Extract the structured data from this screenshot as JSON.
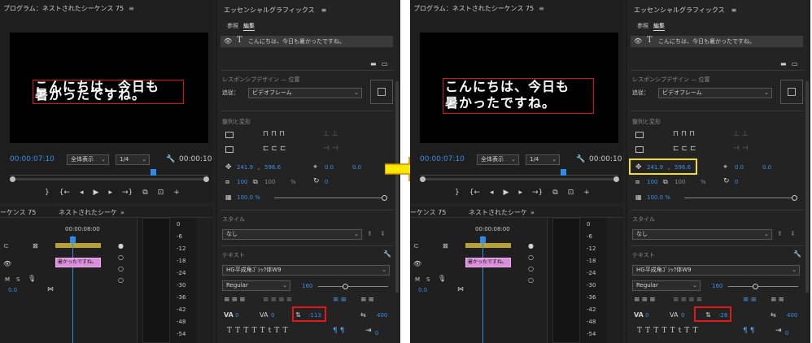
{
  "program_monitor": {
    "title": "プログラム：ネストされたシーケンス 75",
    "menu_icon": "≡",
    "timecode_left": "00:00:07:10",
    "fit_option": "全体表示",
    "quality_option": "1/4",
    "timecode_right": "00:00:10"
  },
  "preview_before": {
    "line1": "こんにちは、今日も",
    "line2": "暑かったですね。"
  },
  "preview_after": {
    "line1": "こんにちは、今日も",
    "line2": "暑かったですね。"
  },
  "timeline": {
    "tab_left": "ーケンス 75",
    "tab_right": "ネストされたシーケ",
    "tab_more": "»",
    "ruler_time": "00:00:08:00",
    "clip_label": "暑かったですね。",
    "track_volume": "0.0",
    "track_m": "M",
    "track_s": "S",
    "meter_scale": [
      "0",
      "-6",
      "-12",
      "-18",
      "-24",
      "-30",
      "-36",
      "-42",
      "-48",
      "-54"
    ]
  },
  "essential_graphics": {
    "title": "エッセンシャルグラフィックス",
    "menu_icon": "≡",
    "tab_browse": "参照",
    "tab_edit": "編集",
    "layer_text": "こんにちは、今日も暑かったですね。",
    "responsive_label": "レスポンシブデザイン — 位置",
    "pin_label": "追従：",
    "pin_value": "ビデオフレーム",
    "align_label": "整列と変形",
    "pos_x": "241.9",
    "pos_y": "596.6",
    "rot_a": "0.0",
    "rot_b": "0.0",
    "scale": "100",
    "scale_h": "100",
    "percent": "%",
    "rotation": "0",
    "opacity": "100.0 %",
    "style_label": "スタイル",
    "style_value": "なし",
    "text_label": "テキスト",
    "font": "HG平成角ｺﾞｼｯｸ体W9",
    "font_style": "Regular",
    "font_size": "160",
    "kerning": "0",
    "tracking": "0",
    "leading": "400",
    "tsume_before": "-113",
    "tsume_after": "-26"
  },
  "colors": {
    "accent_blue": "#3a8ee6",
    "highlight_red": "#e01818",
    "highlight_yellow": "#f0e020",
    "arrow_yellow": "#ffe800"
  }
}
